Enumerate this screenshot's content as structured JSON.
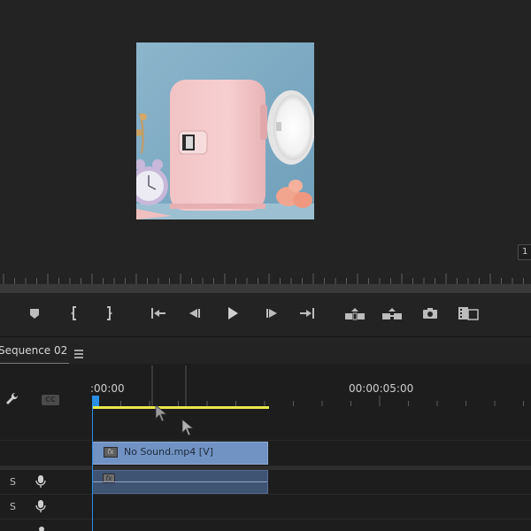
{
  "monitor": {
    "scale_label": "1",
    "preview_icon": "mini-fridge-video-frame"
  },
  "transport": {
    "buttons": [
      {
        "name": "add-marker-button",
        "icon": "marker-icon"
      },
      {
        "name": "mark-in-button",
        "icon": "mark-in-icon"
      },
      {
        "name": "mark-out-button",
        "icon": "mark-out-icon"
      },
      {
        "name": "go-to-in-button",
        "icon": "go-to-in-icon"
      },
      {
        "name": "step-back-button",
        "icon": "step-back-icon"
      },
      {
        "name": "play-button",
        "icon": "play-icon"
      },
      {
        "name": "step-forward-button",
        "icon": "step-forward-icon"
      },
      {
        "name": "go-to-out-button",
        "icon": "go-to-out-icon"
      },
      {
        "name": "lift-button",
        "icon": "lift-icon"
      },
      {
        "name": "extract-button",
        "icon": "extract-icon"
      },
      {
        "name": "export-frame-button",
        "icon": "camera-icon"
      },
      {
        "name": "comparison-view-button",
        "icon": "comparison-icon"
      }
    ]
  },
  "timeline": {
    "sequence_tab": "Sequence 02",
    "ruler": {
      "start_tc": ":00:00",
      "mid_tc": "00:00:05:00"
    },
    "header": {
      "cc_label": "CC"
    },
    "tracks": {
      "audio_1_label": "S",
      "audio_2_label": "S"
    },
    "video_clip": {
      "fx_label": "fx",
      "name": "No Sound.mp4 [V]"
    },
    "audio_clip": {
      "fx_label": "fx"
    }
  },
  "colors": {
    "background": "#232323",
    "timeline_bg": "#1d1d1d",
    "video_clip": "#7193c4",
    "audio_clip": "#3f5373",
    "work_area": "#e8e84a",
    "playhead": "#2b8fe6"
  }
}
